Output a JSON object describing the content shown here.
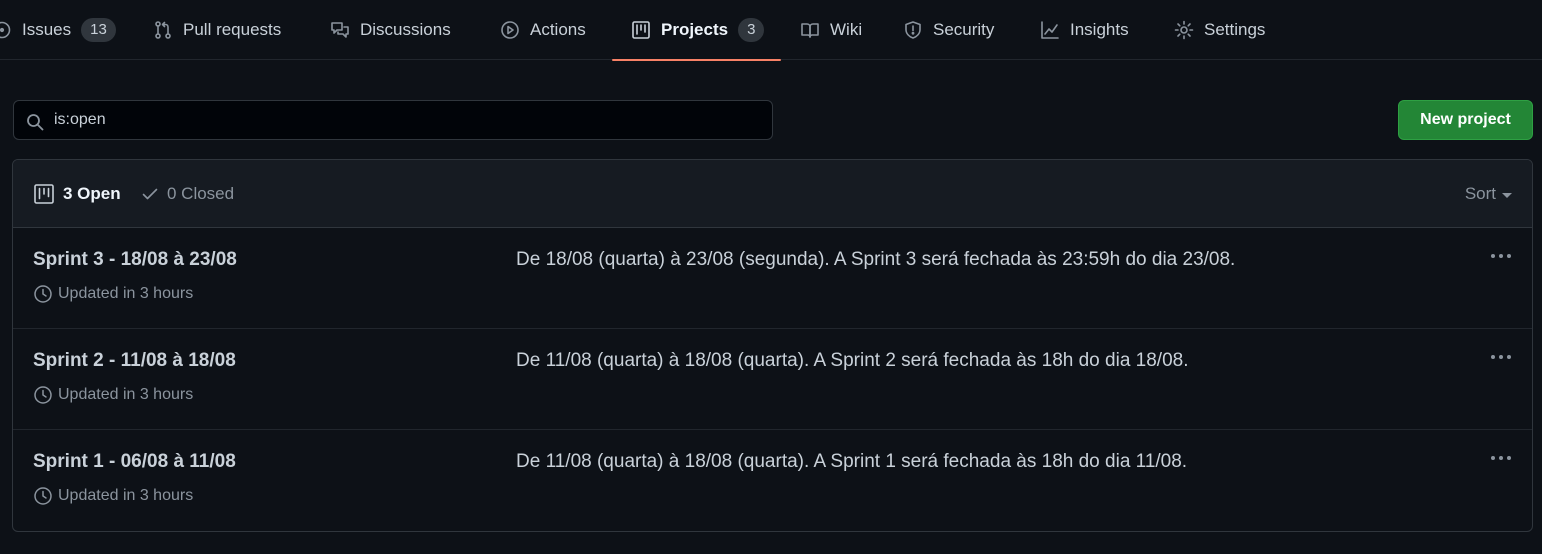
{
  "tabs": [
    {
      "label": "Issues",
      "icon": "issue-opened-icon",
      "counter": "13"
    },
    {
      "label": "Pull requests",
      "icon": "git-pull-request-icon",
      "counter": null
    },
    {
      "label": "Discussions",
      "icon": "comment-discussion-icon",
      "counter": null
    },
    {
      "label": "Actions",
      "icon": "play-icon",
      "counter": null
    },
    {
      "label": "Projects",
      "icon": "project-icon",
      "counter": "3",
      "selected": true
    },
    {
      "label": "Wiki",
      "icon": "book-icon",
      "counter": null
    },
    {
      "label": "Security",
      "icon": "shield-icon",
      "counter": null
    },
    {
      "label": "Insights",
      "icon": "graph-icon",
      "counter": null
    },
    {
      "label": "Settings",
      "icon": "gear-icon",
      "counter": null
    }
  ],
  "search": {
    "value": "is:open",
    "icon": "search-icon"
  },
  "new_project_label": "New project",
  "states": {
    "open": "3 Open",
    "closed": "0 Closed"
  },
  "sort_label": "Sort",
  "projects": [
    {
      "name": "Sprint 3 - 18/08 à 23/08",
      "updated": "Updated in 3 hours",
      "description": "De 18/08 (quarta) à 23/08 (segunda). A Sprint 3 será fechada às 23:59h do dia 23/08."
    },
    {
      "name": "Sprint 2 - 11/08 à 18/08",
      "updated": "Updated in 3 hours",
      "description": "De 11/08 (quarta) à 18/08 (quarta). A Sprint 2 será fechada às 18h do dia 18/08."
    },
    {
      "name": "Sprint 1 - 06/08 à 11/08",
      "updated": "Updated in 3 hours",
      "description": "De 11/08 (quarta) à 18/08 (quarta). A Sprint 1 será fechada às 18h do dia 11/08."
    }
  ],
  "colors": {
    "background": "#0d1117",
    "accent_underline": "#f78166",
    "primary_button": "#238636"
  }
}
